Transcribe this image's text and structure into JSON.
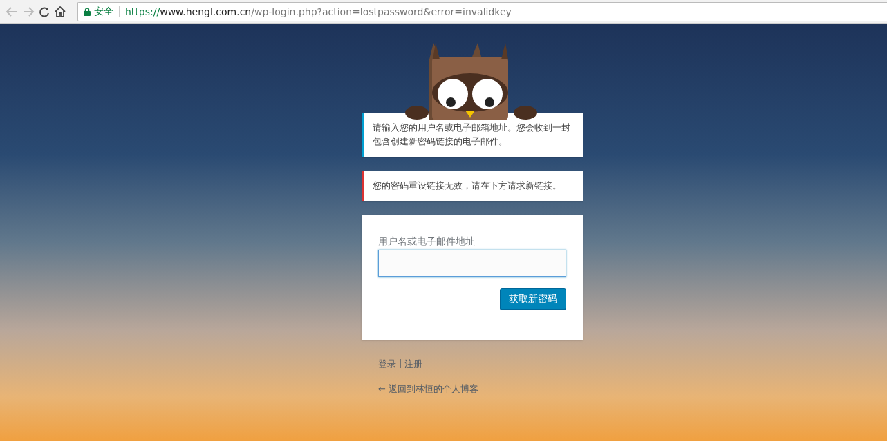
{
  "browser": {
    "secure_label": "安全",
    "url_scheme": "https://",
    "url_host": "www.hengl.com.cn",
    "url_path": "/wp-login.php?action=lostpassword&error=invalidkey"
  },
  "notices": [
    {
      "kind": "info",
      "text": "请输入您的用户名或电子邮箱地址。您会收到一封包含创建新密码链接的电子邮件。"
    },
    {
      "kind": "error",
      "text": "您的密码重设链接无效，请在下方请求新链接。"
    }
  ],
  "form": {
    "label": "用户名或电子邮件地址",
    "button": "获取新密码"
  },
  "nav": {
    "login": "登录",
    "separator": "|",
    "register": "注册"
  },
  "back_link": "← 返回到林恒的个人博客"
}
